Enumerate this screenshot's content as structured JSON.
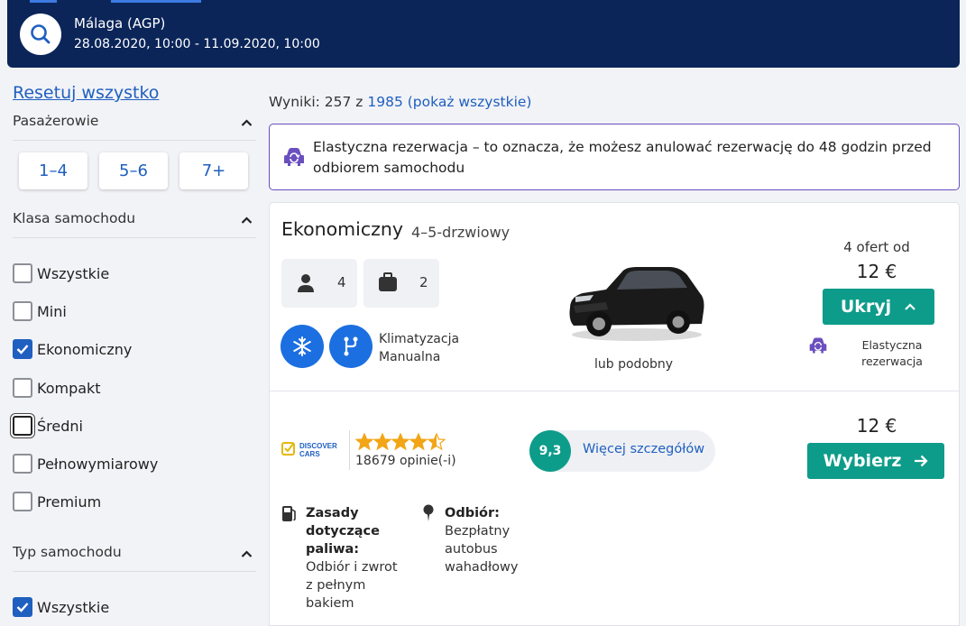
{
  "header": {
    "location": "Málaga (AGP)",
    "dates": "28.08.2020, 10:00 - 11.09.2020, 10:00"
  },
  "sidebar": {
    "reset_label": "Resetuj wszystko",
    "passengers": {
      "title": "Pasażerowie",
      "options": [
        "1–4",
        "5–6",
        "7+"
      ]
    },
    "car_class": {
      "title": "Klasa samochodu",
      "items": [
        {
          "label": "Wszystkie",
          "checked": false
        },
        {
          "label": "Mini",
          "checked": false
        },
        {
          "label": "Ekonomiczny",
          "checked": true
        },
        {
          "label": "Kompakt",
          "checked": false
        },
        {
          "label": "Średni",
          "checked": false
        },
        {
          "label": "Pełnowymiarowy",
          "checked": false
        },
        {
          "label": "Premium",
          "checked": false
        }
      ]
    },
    "car_type": {
      "title": "Typ samochodu",
      "items": [
        {
          "label": "Wszystkie",
          "checked": true
        }
      ]
    }
  },
  "results": {
    "prefix": "Wyniki: 257 z ",
    "link": "1985 (pokaż wszystkie)"
  },
  "info": {
    "text": "Elastyczna rezerwacja – to oznacza, że możesz anulować rezerwację do 48 godzin przed odbiorem samochodu"
  },
  "car": {
    "category": "Ekonomiczny",
    "doors": "4–5-drzwiowy",
    "passengers": "4",
    "bags": "2",
    "feature_ac": "Klimatyzacja",
    "feature_gear": "Manualna",
    "image_caption": "lub podobny",
    "offers_label": "4 ofert od",
    "price_from": "12 €",
    "hide_button": "Ukryj",
    "flex_label": "Elastyczna rezerwacja"
  },
  "offer": {
    "supplier_logo_text": "DISCOVER CARS",
    "rating_stars": 4.5,
    "reviews": "18679 opinie(-i)",
    "score": "9,3",
    "details_link": "Więcej szczegółów",
    "price": "12 €",
    "select_button": "Wybierz",
    "fuel_title": "Zasady dotyczące paliwa:",
    "fuel_text": "Odbiór i zwrot z pełnym bakiem",
    "pickup_title": "Odbiór:",
    "pickup_text": "Bezpłatny autobus wahadłowy"
  },
  "colors": {
    "header_bg": "#0b2559",
    "accent_blue": "#1f5fbf",
    "green": "#0e9c8a",
    "flex_purple": "#6a4fbf"
  }
}
